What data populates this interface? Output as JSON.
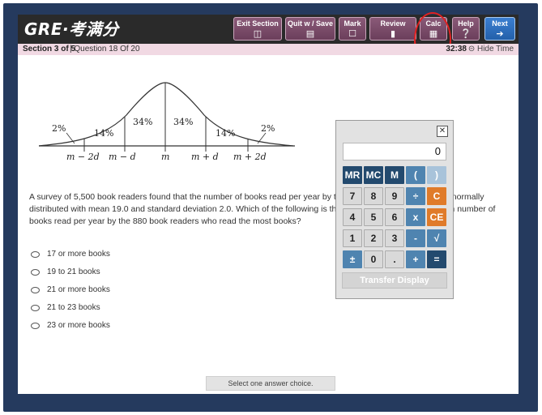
{
  "app": {
    "logo": "GRE·考满分"
  },
  "toolbar": {
    "exit_section": "Exit Section",
    "quit_save": "Quit w / Save",
    "mark": "Mark",
    "review": "Review",
    "calc": "Calc",
    "help": "Help",
    "next": "Next"
  },
  "status": {
    "section": "Section 3 of 5",
    "question": "Question 18 Of 20",
    "timer": "32:38",
    "hide_time": "Hide Time"
  },
  "figure": {
    "percents": [
      "2%",
      "14%",
      "34%",
      "34%",
      "14%",
      "2%"
    ],
    "tick_labels": [
      "m − 2d",
      "m − d",
      "m",
      "m + d",
      "m + 2d"
    ]
  },
  "question": {
    "text": "A survey of 5,500 book readers found that the number of books read per year by the readers was approximately normally distributed with mean 19.0 and standard deviation 2.0. Which of the following is the best estimate of the minimum number of books read per year by the 880 book readers who read the most books?",
    "options": [
      "17 or more books",
      "19 to 21 books",
      "21 or more books",
      "21 to 23 books",
      "23 or more books"
    ],
    "hint": "Select one answer choice."
  },
  "calculator": {
    "close": "✕",
    "display": "0",
    "keys": [
      [
        "MR",
        "MC",
        "M",
        "(",
        ")"
      ],
      [
        "7",
        "8",
        "9",
        "÷",
        "C"
      ],
      [
        "4",
        "5",
        "6",
        "x",
        "CE"
      ],
      [
        "1",
        "2",
        "3",
        "-",
        "√"
      ],
      [
        "±",
        "0",
        ".",
        "+",
        "="
      ]
    ],
    "transfer": "Transfer Display"
  },
  "colors": {
    "frame": "#253a5e",
    "topbar": "#2a2a2a",
    "toolbar_button": "#7a4b69",
    "next_button": "#2f6fc0",
    "status_bar": "#f1d9e3",
    "calc_dark": "#234a6e",
    "calc_orange": "#e07b2a",
    "highlight_circle": "#e02020"
  },
  "icons": {
    "exit_section": "door-icon",
    "quit_save": "save-icon",
    "mark": "checkbox-icon",
    "review": "bookmark-icon",
    "calc": "calculator-icon",
    "help": "question-icon",
    "next": "arrow-right-icon",
    "hide_time": "minus-circle-icon"
  }
}
